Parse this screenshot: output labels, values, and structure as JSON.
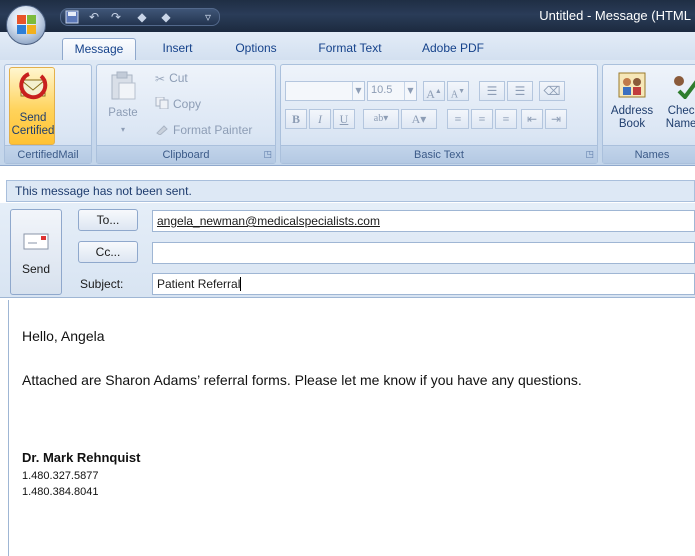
{
  "window": {
    "title": "Untitled - Message (HTML"
  },
  "ribbon_tabs": [
    "Message",
    "Insert",
    "Options",
    "Format Text",
    "Adobe PDF"
  ],
  "certifiedmail": {
    "button_label": "Send Certified",
    "group_label": "CertifiedMail"
  },
  "clipboard": {
    "paste_label": "Paste",
    "cut_label": "Cut",
    "copy_label": "Copy",
    "format_painter_label": "Format Painter",
    "group_label": "Clipboard"
  },
  "basic_text": {
    "font_size": "10.5",
    "group_label": "Basic Text"
  },
  "names": {
    "address_book_label": "Address Book",
    "check_names_label": "Check Names",
    "group_label": "Names"
  },
  "info_bar": {
    "text": "This message has not been sent."
  },
  "header": {
    "send_label": "Send",
    "to_button": "To...",
    "cc_button": "Cc...",
    "subject_label": "Subject:",
    "to_value": "angela_newman@medicalspecialists.com",
    "cc_value": "",
    "subject_value": "Patient Referral"
  },
  "body": {
    "greeting": "Hello, Angela",
    "message": "Attached are Sharon Adams’ referral forms.  Please let me know if you have any questions.",
    "signature_name": "Dr. Mark Rehnquist",
    "phone1": "1.480.327.5877",
    "phone2": "1.480.384.8041"
  },
  "icons": [
    "office-button-icon",
    "save-icon",
    "undo-icon",
    "redo-icon",
    "up-arrow-icon",
    "down-arrow-icon",
    "customize-icon",
    "certified-mail-icon",
    "paste-icon",
    "cut-icon",
    "copy-icon",
    "format-painter-icon",
    "address-book-icon",
    "check-names-icon",
    "send-envelope-icon"
  ]
}
